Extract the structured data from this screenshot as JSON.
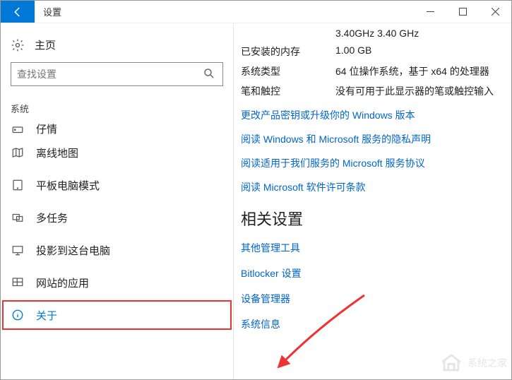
{
  "titlebar": {
    "title": "设置"
  },
  "sidebar": {
    "home_label": "主页",
    "search_placeholder": "查找设置",
    "section_label": "系统",
    "items": [
      {
        "label": "仔情"
      },
      {
        "label": "离线地图"
      },
      {
        "label": "平板电脑模式"
      },
      {
        "label": "多任务"
      },
      {
        "label": "投影到这台电脑"
      },
      {
        "label": "网站的应用"
      },
      {
        "label": "关于"
      }
    ]
  },
  "main": {
    "specs": [
      {
        "key": "",
        "val": "3.40GHz   3.40 GHz"
      },
      {
        "key": "已安装的内存",
        "val": "1.00 GB"
      },
      {
        "key": "系统类型",
        "val": "64 位操作系统，基于 x64 的处理器"
      },
      {
        "key": "笔和触控",
        "val": "没有可用于此显示器的笔或触控输入"
      }
    ],
    "links": [
      "更改产品密钥或升级你的 Windows 版本",
      "阅读 Windows 和 Microsoft 服务的隐私声明",
      "阅读适用于我们服务的 Microsoft 服务协议",
      "阅读 Microsoft 软件许可条款"
    ],
    "related_heading": "相关设置",
    "related_links": [
      "其他管理工具",
      "Bitlocker 设置",
      "设备管理器",
      "系统信息"
    ]
  },
  "watermark": "系统之家"
}
